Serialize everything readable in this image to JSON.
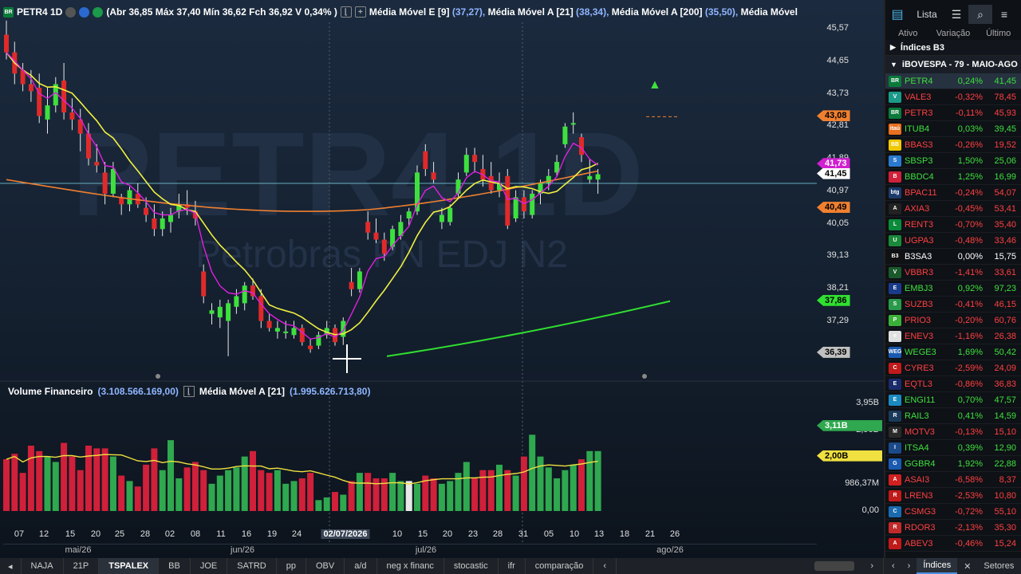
{
  "header": {
    "symbol_interval": "PETR4 1D",
    "ohlc": "(Abr 36,85 Máx 37,40 Mín 36,62 Fch 36,92 V 0,34% )",
    "studies": [
      {
        "label": "Média Móvel E [9]",
        "value": "(37,27),"
      },
      {
        "label": "Média Móvel A [21]",
        "value": "(38,34),"
      },
      {
        "label": "Média Móvel A [200]",
        "value": "(35,50),"
      },
      {
        "label": "Média Móvel",
        "value": ""
      }
    ]
  },
  "watermark": {
    "symbol": "PETR4 1D",
    "name": "Petrobras PN EDJ N2"
  },
  "price_axis": [
    "45,57",
    "44,65",
    "43,73",
    "42,81",
    "41,89",
    "40,97",
    "40,05",
    "39,13",
    "38,21",
    "37,29"
  ],
  "price_tags": [
    {
      "label": "43,08",
      "color": "#f08030",
      "text": "#000"
    },
    {
      "label": "41,73",
      "color": "#d020d0",
      "text": "#fff"
    },
    {
      "label": "41,45",
      "color": "#ffffff",
      "text": "#000"
    },
    {
      "label": "40,49",
      "color": "#f08030",
      "text": "#000"
    },
    {
      "label": "37,86",
      "color": "#30e030",
      "text": "#000"
    },
    {
      "label": "36,39",
      "color": "#c0c0c0",
      "text": "#000"
    }
  ],
  "volume_header": {
    "label": "Volume Financeiro",
    "value": "(3.108.566.169,00)",
    "ma_label": "Média Móvel A [21]",
    "ma_value": "(1.995.626.713,80)"
  },
  "volume_axis": [
    "3,95B",
    "2,96B",
    "986,37M",
    "0,00"
  ],
  "volume_tags": [
    {
      "label": "3,11B",
      "color": "#2fa84f",
      "text": "#fff"
    },
    {
      "label": "2,00B",
      "color": "#f0e040",
      "text": "#000"
    }
  ],
  "x_axis": {
    "days": [
      "07",
      "12",
      "15",
      "20",
      "25",
      "28",
      "02",
      "08",
      "11",
      "16",
      "19",
      "24",
      "02/07/2026",
      "10",
      "15",
      "20",
      "23",
      "28",
      "31",
      "05",
      "10",
      "13",
      "18",
      "21",
      "26"
    ],
    "months": [
      "mai/26",
      "jun/26",
      "jul/26",
      "ago/26"
    ]
  },
  "tabs": [
    "NAJA",
    "21P",
    "TSPALEX",
    "BB",
    "JOE",
    "SATRD",
    "pp",
    "OBV",
    "a/d",
    "neg x financ",
    "stocastic",
    "ifr",
    "comparação"
  ],
  "active_tab": "TSPALEX",
  "chart_data": {
    "type": "candlestick",
    "symbol": "PETR4",
    "interval": "1D",
    "candles": [
      {
        "o": 45.4,
        "h": 45.8,
        "l": 44.7,
        "c": 44.9
      },
      {
        "o": 44.9,
        "h": 45.2,
        "l": 44.0,
        "c": 44.3
      },
      {
        "o": 44.4,
        "h": 44.6,
        "l": 43.8,
        "c": 44.0
      },
      {
        "o": 44.0,
        "h": 44.4,
        "l": 43.5,
        "c": 43.8
      },
      {
        "o": 43.9,
        "h": 44.3,
        "l": 42.9,
        "c": 43.1
      },
      {
        "o": 43.0,
        "h": 43.9,
        "l": 42.6,
        "c": 43.4
      },
      {
        "o": 43.4,
        "h": 44.2,
        "l": 43.2,
        "c": 44.0
      },
      {
        "o": 44.1,
        "h": 44.6,
        "l": 43.0,
        "c": 43.2
      },
      {
        "o": 43.2,
        "h": 43.6,
        "l": 42.7,
        "c": 43.0
      },
      {
        "o": 43.0,
        "h": 43.3,
        "l": 42.1,
        "c": 42.6
      },
      {
        "o": 42.6,
        "h": 42.9,
        "l": 41.7,
        "c": 41.9
      },
      {
        "o": 41.8,
        "h": 42.3,
        "l": 41.5,
        "c": 41.7
      },
      {
        "o": 41.5,
        "h": 41.8,
        "l": 40.6,
        "c": 40.9
      },
      {
        "o": 40.9,
        "h": 41.8,
        "l": 40.8,
        "c": 41.6
      },
      {
        "o": 40.8,
        "h": 40.9,
        "l": 40.3,
        "c": 40.6
      },
      {
        "o": 40.6,
        "h": 41.1,
        "l": 40.4,
        "c": 41.0
      },
      {
        "o": 40.9,
        "h": 41.2,
        "l": 40.5,
        "c": 40.6
      },
      {
        "o": 40.5,
        "h": 40.8,
        "l": 40.1,
        "c": 40.3
      },
      {
        "o": 40.2,
        "h": 40.6,
        "l": 39.7,
        "c": 39.9
      },
      {
        "o": 39.9,
        "h": 40.4,
        "l": 39.7,
        "c": 40.2
      },
      {
        "o": 40.1,
        "h": 40.5,
        "l": 39.8,
        "c": 40.3
      },
      {
        "o": 40.4,
        "h": 40.9,
        "l": 40.2,
        "c": 40.6
      },
      {
        "o": 40.6,
        "h": 41.0,
        "l": 40.3,
        "c": 40.5
      },
      {
        "o": 40.4,
        "h": 40.7,
        "l": 40.0,
        "c": 40.2
      },
      {
        "o": 38.7,
        "h": 38.9,
        "l": 37.8,
        "c": 38.0
      },
      {
        "o": 37.5,
        "h": 37.8,
        "l": 37.2,
        "c": 37.6
      },
      {
        "o": 37.4,
        "h": 37.9,
        "l": 37.1,
        "c": 37.7
      },
      {
        "o": 37.3,
        "h": 37.9,
        "l": 36.3,
        "c": 37.8
      },
      {
        "o": 37.7,
        "h": 38.2,
        "l": 37.5,
        "c": 38.0
      },
      {
        "o": 37.8,
        "h": 38.4,
        "l": 37.6,
        "c": 38.3
      },
      {
        "o": 38.3,
        "h": 38.5,
        "l": 37.9,
        "c": 38.0
      },
      {
        "o": 38.0,
        "h": 38.2,
        "l": 37.1,
        "c": 37.3
      },
      {
        "o": 37.3,
        "h": 37.5,
        "l": 37.0,
        "c": 37.1
      },
      {
        "o": 37.0,
        "h": 37.3,
        "l": 36.8,
        "c": 37.1
      },
      {
        "o": 37.0,
        "h": 37.3,
        "l": 36.8,
        "c": 37.0
      },
      {
        "o": 36.9,
        "h": 37.3,
        "l": 36.8,
        "c": 37.1
      },
      {
        "o": 37.1,
        "h": 37.2,
        "l": 36.6,
        "c": 36.7
      },
      {
        "o": 36.6,
        "h": 36.8,
        "l": 36.4,
        "c": 36.5
      },
      {
        "o": 36.6,
        "h": 37.0,
        "l": 36.5,
        "c": 36.9
      },
      {
        "o": 36.9,
        "h": 37.3,
        "l": 36.8,
        "c": 37.1
      },
      {
        "o": 37.1,
        "h": 37.2,
        "l": 36.6,
        "c": 36.7
      },
      {
        "o": 36.85,
        "h": 37.4,
        "l": 36.62,
        "c": 37.3
      },
      {
        "o": 38.4,
        "h": 38.8,
        "l": 38.0,
        "c": 38.2
      },
      {
        "o": 38.2,
        "h": 38.8,
        "l": 38.1,
        "c": 38.7
      },
      {
        "o": 40.1,
        "h": 40.4,
        "l": 39.6,
        "c": 39.8
      },
      {
        "o": 39.8,
        "h": 40.2,
        "l": 39.5,
        "c": 39.6
      },
      {
        "o": 39.6,
        "h": 39.8,
        "l": 39.0,
        "c": 39.2
      },
      {
        "o": 39.4,
        "h": 40.0,
        "l": 39.3,
        "c": 39.9
      },
      {
        "o": 39.7,
        "h": 40.3,
        "l": 39.6,
        "c": 40.1
      },
      {
        "o": 40.2,
        "h": 40.5,
        "l": 40.0,
        "c": 40.4
      },
      {
        "o": 40.4,
        "h": 41.7,
        "l": 40.3,
        "c": 41.5
      },
      {
        "o": 42.1,
        "h": 42.3,
        "l": 41.4,
        "c": 41.6
      },
      {
        "o": 41.5,
        "h": 41.8,
        "l": 41.2,
        "c": 41.3
      },
      {
        "o": 40.1,
        "h": 40.5,
        "l": 39.9,
        "c": 40.3
      },
      {
        "o": 40.1,
        "h": 40.6,
        "l": 40.0,
        "c": 40.5
      },
      {
        "o": 40.9,
        "h": 41.5,
        "l": 40.8,
        "c": 41.3
      },
      {
        "o": 41.5,
        "h": 42.2,
        "l": 41.4,
        "c": 42.0
      },
      {
        "o": 42.0,
        "h": 42.2,
        "l": 41.5,
        "c": 41.8
      },
      {
        "o": 41.6,
        "h": 42.0,
        "l": 41.1,
        "c": 41.3
      },
      {
        "o": 41.4,
        "h": 41.8,
        "l": 40.9,
        "c": 41.0
      },
      {
        "o": 41.0,
        "h": 41.5,
        "l": 40.8,
        "c": 41.2
      },
      {
        "o": 41.4,
        "h": 41.6,
        "l": 39.9,
        "c": 40.0
      },
      {
        "o": 40.2,
        "h": 41.0,
        "l": 40.1,
        "c": 40.8
      },
      {
        "o": 40.8,
        "h": 41.0,
        "l": 40.2,
        "c": 40.4
      },
      {
        "o": 40.3,
        "h": 41.0,
        "l": 40.2,
        "c": 40.9
      },
      {
        "o": 40.9,
        "h": 41.3,
        "l": 40.6,
        "c": 41.2
      },
      {
        "o": 41.2,
        "h": 41.6,
        "l": 41.0,
        "c": 41.4
      },
      {
        "o": 41.5,
        "h": 42.0,
        "l": 41.4,
        "c": 41.8
      },
      {
        "o": 42.3,
        "h": 42.9,
        "l": 42.2,
        "c": 42.8
      },
      {
        "o": 42.9,
        "h": 43.2,
        "l": 42.6,
        "c": 42.9
      },
      {
        "o": 42.5,
        "h": 42.6,
        "l": 41.8,
        "c": 42.0
      },
      {
        "o": 41.3,
        "h": 41.9,
        "l": 41.2,
        "c": 41.4
      },
      {
        "o": 41.3,
        "h": 41.6,
        "l": 40.9,
        "c": 41.45
      }
    ],
    "y_range": [
      36.2,
      46.0
    ],
    "moving_averages": [
      {
        "name": "Média Móvel E [9]",
        "color": "#e020e0",
        "value": 41.73
      },
      {
        "name": "Média Móvel A [21]",
        "color": "#f0f040",
        "value": 41.45
      },
      {
        "name": "Média Móvel A [200]",
        "color": "#f08030",
        "value": 40.49
      },
      {
        "name": "Média Móvel",
        "color": "#30e030",
        "value": 37.86
      }
    ],
    "volume": {
      "last": 3108566169,
      "ma21": 1995626713.8,
      "y_range": [
        0,
        3.95
      ]
    }
  },
  "sidebar": {
    "lista_label": "Lista",
    "cols": [
      "Ativo",
      "Variação",
      "Último"
    ],
    "group": "Índices B3",
    "subgroup": "iBOVESPA - 79 - MAIO-AGO",
    "rows": [
      {
        "sym": "PETR4",
        "var": "0,24%",
        "last": "41,45",
        "icolor": "#0a7a3a",
        "itext": "BR",
        "up": true
      },
      {
        "sym": "VALE3",
        "var": "-0,32%",
        "last": "78,45",
        "icolor": "#1b9a8a",
        "itext": "V",
        "up": false
      },
      {
        "sym": "PETR3",
        "var": "-0,11%",
        "last": "45,93",
        "icolor": "#0a7a3a",
        "itext": "BR",
        "up": false
      },
      {
        "sym": "ITUB4",
        "var": "0,03%",
        "last": "39,45",
        "icolor": "#e87020",
        "itext": "itaú",
        "up": true
      },
      {
        "sym": "BBAS3",
        "var": "-0,26%",
        "last": "19,52",
        "icolor": "#f0c800",
        "itext": "BB",
        "up": false
      },
      {
        "sym": "SBSP3",
        "var": "1,50%",
        "last": "25,06",
        "icolor": "#2a7ad0",
        "itext": "S",
        "up": true
      },
      {
        "sym": "BBDC4",
        "var": "1,25%",
        "last": "16,99",
        "icolor": "#d0203a",
        "itext": "B",
        "up": true
      },
      {
        "sym": "BPAC11",
        "var": "-0,24%",
        "last": "54,07",
        "icolor": "#1c3a6a",
        "itext": "btg",
        "up": false
      },
      {
        "sym": "AXIA3",
        "var": "-0,45%",
        "last": "53,41",
        "icolor": "#222",
        "itext": "A",
        "up": false
      },
      {
        "sym": "RENT3",
        "var": "-0,70%",
        "last": "35,40",
        "icolor": "#0a8a3a",
        "itext": "L",
        "up": false
      },
      {
        "sym": "UGPA3",
        "var": "-0,48%",
        "last": "33,46",
        "icolor": "#1a8a3a",
        "itext": "U",
        "up": false
      },
      {
        "sym": "B3SA3",
        "var": "0,00%",
        "last": "15,75",
        "icolor": "#111",
        "itext": "B3",
        "up": null
      },
      {
        "sym": "VBBR3",
        "var": "-1,41%",
        "last": "33,61",
        "icolor": "#1a5a2a",
        "itext": "V",
        "up": false
      },
      {
        "sym": "EMBJ3",
        "var": "0,92%",
        "last": "97,23",
        "icolor": "#1a3a8a",
        "itext": "E",
        "up": true
      },
      {
        "sym": "SUZB3",
        "var": "-0,41%",
        "last": "46,15",
        "icolor": "#2a9a4a",
        "itext": "S",
        "up": false
      },
      {
        "sym": "PRIO3",
        "var": "-0,20%",
        "last": "60,76",
        "icolor": "#3ab03a",
        "itext": "P",
        "up": false
      },
      {
        "sym": "ENEV3",
        "var": "-1,16%",
        "last": "26,38",
        "icolor": "#e0e0e0",
        "itext": "e",
        "up": false
      },
      {
        "sym": "WEGE3",
        "var": "1,69%",
        "last": "50,42",
        "icolor": "#1a5ab0",
        "itext": "WEG",
        "up": true
      },
      {
        "sym": "CYRE3",
        "var": "-2,59%",
        "last": "24,09",
        "icolor": "#c01a1a",
        "itext": "C",
        "up": false
      },
      {
        "sym": "EQTL3",
        "var": "-0,86%",
        "last": "36,83",
        "icolor": "#1a2a6a",
        "itext": "E",
        "up": false
      },
      {
        "sym": "ENGI11",
        "var": "0,70%",
        "last": "47,57",
        "icolor": "#1a8ac0",
        "itext": "E",
        "up": true
      },
      {
        "sym": "RAIL3",
        "var": "0,41%",
        "last": "14,59",
        "icolor": "#1a3a5a",
        "itext": "R",
        "up": true
      },
      {
        "sym": "MOTV3",
        "var": "-0,13%",
        "last": "15,10",
        "icolor": "#2a2a2a",
        "itext": "M",
        "up": false
      },
      {
        "sym": "ITSA4",
        "var": "0,39%",
        "last": "12,90",
        "icolor": "#1a4a8a",
        "itext": "I",
        "up": true
      },
      {
        "sym": "GGBR4",
        "var": "1,92%",
        "last": "22,88",
        "icolor": "#1a5ab0",
        "itext": "G",
        "up": true
      },
      {
        "sym": "ASAI3",
        "var": "-6,58%",
        "last": "8,37",
        "icolor": "#d02020",
        "itext": "A",
        "up": false
      },
      {
        "sym": "LREN3",
        "var": "-2,53%",
        "last": "10,80",
        "icolor": "#c01a1a",
        "itext": "R",
        "up": false
      },
      {
        "sym": "CSMG3",
        "var": "-0,72%",
        "last": "55,10",
        "icolor": "#1a6ab0",
        "itext": "C",
        "up": false
      },
      {
        "sym": "RDOR3",
        "var": "-2,13%",
        "last": "35,30",
        "icolor": "#c02a2a",
        "itext": "R",
        "up": false
      },
      {
        "sym": "ABEV3",
        "var": "-0,46%",
        "last": "15,24",
        "icolor": "#c01a1a",
        "itext": "A",
        "up": false
      }
    ],
    "footer": [
      "Índices",
      "Setores"
    ],
    "footer_active": "Índices"
  }
}
